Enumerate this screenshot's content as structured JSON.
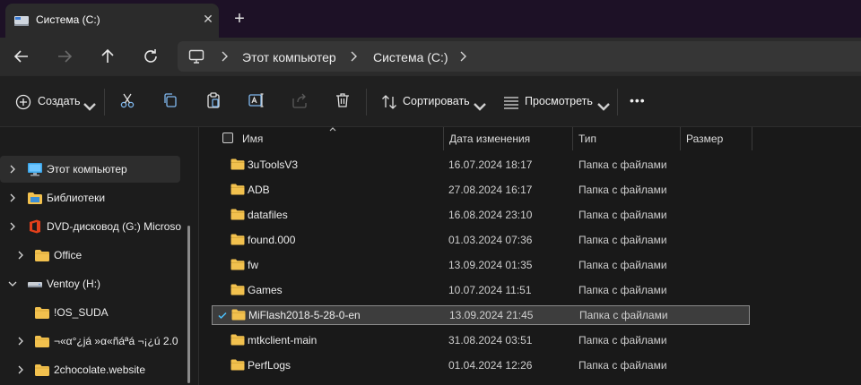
{
  "tab": {
    "title": "Система (C:)",
    "close_glyph": "✕",
    "new_glyph": "+"
  },
  "breadcrumb": [
    "Этот компьютер",
    "Система (C:)"
  ],
  "commands": {
    "create": "Создать",
    "sort": "Сортировать",
    "view": "Просмотреть",
    "more": "•••"
  },
  "sidebar": {
    "items": [
      {
        "label": "Этот компьютер",
        "icon": "computer-icon",
        "expander": "chevron-right"
      },
      {
        "label": "Библиотеки",
        "icon": "library-folder-icon",
        "expander": "chevron-right"
      },
      {
        "label": "DVD-дисковод (G:) Microsof",
        "icon": "office-dvd-icon",
        "expander": "chevron-right"
      },
      {
        "label": "Office",
        "icon": "folder-icon",
        "expander": "chevron-right"
      },
      {
        "label": "Ventoy (H:)",
        "icon": "drive-icon",
        "expander": "chevron-down"
      },
      {
        "label": "!OS_SUDA",
        "icon": "folder-icon",
        "expander": "none"
      },
      {
        "label": "¬«α°¿já »α«ñáªá ¬¡¿ú 2.0",
        "icon": "folder-icon",
        "expander": "chevron-right"
      },
      {
        "label": "2chocolate.website",
        "icon": "folder-icon",
        "expander": "chevron-right"
      }
    ]
  },
  "columns": {
    "name": "Имя",
    "date": "Дата изменения",
    "type": "Тип",
    "size": "Размер"
  },
  "files": [
    {
      "name": "3uToolsV3",
      "date": "16.07.2024 18:17",
      "type": "Папка с файлами"
    },
    {
      "name": "ADB",
      "date": "27.08.2024 16:17",
      "type": "Папка с файлами"
    },
    {
      "name": "datafiles",
      "date": "16.08.2024 23:10",
      "type": "Папка с файлами"
    },
    {
      "name": "found.000",
      "date": "01.03.2024 07:36",
      "type": "Папка с файлами"
    },
    {
      "name": "fw",
      "date": "13.09.2024 01:35",
      "type": "Папка с файлами"
    },
    {
      "name": "Games",
      "date": "10.07.2024 11:51",
      "type": "Папка с файлами"
    },
    {
      "name": "MiFlash2018-5-28-0-en",
      "date": "13.09.2024 21:45",
      "type": "Папка с файлами",
      "selected": true
    },
    {
      "name": "mtkclient-main",
      "date": "31.08.2024 03:51",
      "type": "Папка с файлами"
    },
    {
      "name": "PerfLogs",
      "date": "01.04.2024 12:26",
      "type": "Папка с файлами"
    }
  ],
  "colors": {
    "folder": "#f2c14e",
    "accent": "#4cc2ff",
    "titlebar": "#1d1126"
  }
}
